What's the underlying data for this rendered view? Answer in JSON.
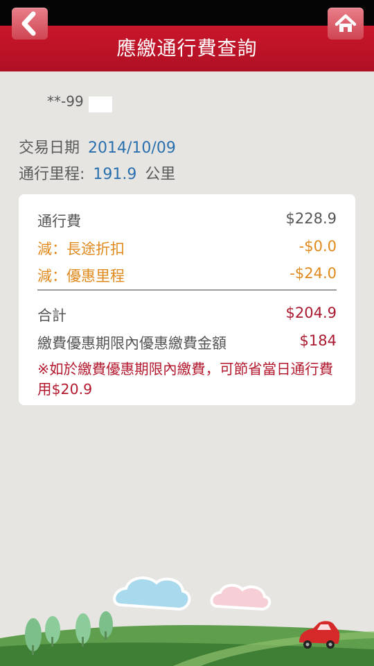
{
  "header": {
    "title": "應繳通行費查詢",
    "back_icon": "chevron-left-icon",
    "home_icon": "home-icon"
  },
  "plate": "**-99",
  "info": {
    "date_label": "交易日期",
    "date_value": "2014/10/09",
    "distance_label": "通行里程:",
    "distance_value": "191.9",
    "distance_unit": "公里"
  },
  "fees": {
    "toll_label": "通行費",
    "toll_value": "$228.9",
    "discount_long_label": "減：長途折扣",
    "discount_long_value": "-$0.0",
    "discount_mileage_label": "減：優惠里程",
    "discount_mileage_value": "-$24.0",
    "total_label": "合計",
    "total_value": "$204.9",
    "promo_label": "繳費優惠期限內優惠繳費金額",
    "promo_value": "$184",
    "note": "※如於繳費優惠期限內繳費，可節省當日通行費用$20.9"
  },
  "colors": {
    "header_red": "#b81228",
    "accent_blue": "#2a6fae",
    "discount_orange": "#e08a1d",
    "total_red": "#a81930",
    "background": "#e6e5e1"
  }
}
